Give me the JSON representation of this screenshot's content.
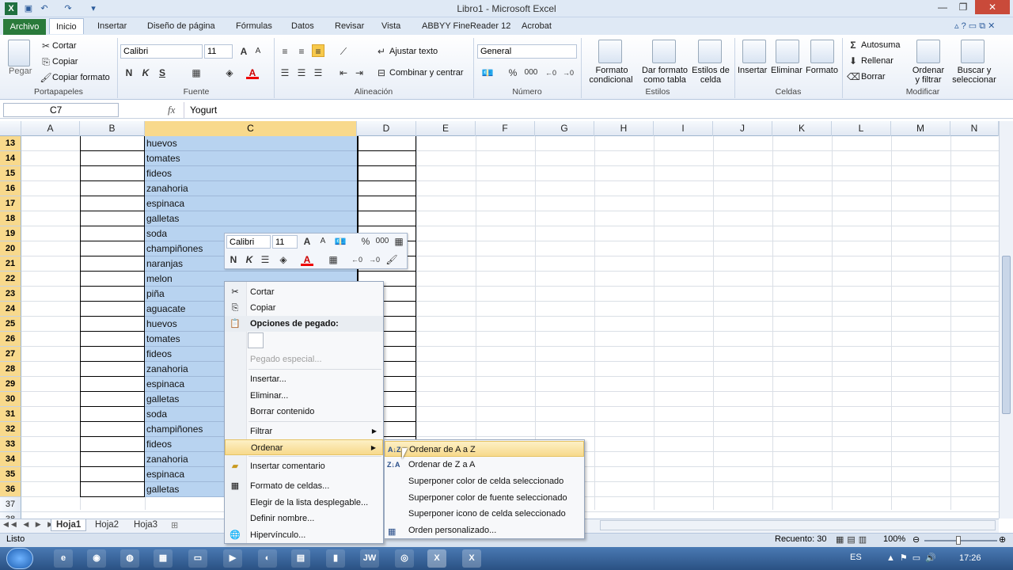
{
  "window": {
    "title": "Libro1 - Microsoft Excel"
  },
  "tabs": [
    "Archivo",
    "Inicio",
    "Insertar",
    "Diseño de página",
    "Fórmulas",
    "Datos",
    "Revisar",
    "Vista",
    "ABBYY FineReader 12",
    "Acrobat"
  ],
  "ribbon": {
    "clipboard": {
      "paste": "Pegar",
      "cut": "Cortar",
      "copy": "Copiar",
      "format_painter": "Copiar formato",
      "label": "Portapapeles"
    },
    "font": {
      "name": "Calibri",
      "size": "11",
      "bold": "N",
      "italic": "K",
      "underline": "S",
      "label": "Fuente"
    },
    "alignment": {
      "wrap": "Ajustar texto",
      "merge": "Combinar y centrar",
      "label": "Alineación"
    },
    "number": {
      "format": "General",
      "percent": "%",
      "thousands": "000",
      "label": "Número"
    },
    "styles": {
      "conditional": "Formato\ncondicional",
      "conditional_1": "Formato",
      "conditional_2": "condicional",
      "table_1": "Dar formato",
      "table_2": "como tabla",
      "cell_1": "Estilos de",
      "cell_2": "celda",
      "label": "Estilos"
    },
    "cells": {
      "insert": "Insertar",
      "delete": "Eliminar",
      "format": "Formato",
      "label": "Celdas"
    },
    "editing": {
      "autosum": "Autosuma",
      "fill": "Rellenar",
      "clear": "Borrar",
      "sort_1": "Ordenar",
      "sort_2": "y filtrar",
      "find_1": "Buscar y",
      "find_2": "seleccionar",
      "label": "Modificar"
    }
  },
  "formula_bar": {
    "name_box": "C7",
    "fx": "fx",
    "value": "Yogurt"
  },
  "columns": [
    "A",
    "B",
    "C",
    "D",
    "E",
    "F",
    "G",
    "H",
    "I",
    "J",
    "K",
    "L",
    "M",
    "N"
  ],
  "rows": [
    {
      "n": "13",
      "c": "huevos"
    },
    {
      "n": "14",
      "c": "tomates"
    },
    {
      "n": "15",
      "c": "fideos"
    },
    {
      "n": "16",
      "c": "zanahoria"
    },
    {
      "n": "17",
      "c": "espinaca"
    },
    {
      "n": "18",
      "c": "galletas"
    },
    {
      "n": "19",
      "c": "soda"
    },
    {
      "n": "20",
      "c": "champiñones"
    },
    {
      "n": "21",
      "c": "naranjas"
    },
    {
      "n": "22",
      "c": "melon"
    },
    {
      "n": "23",
      "c": "piña"
    },
    {
      "n": "24",
      "c": "aguacate"
    },
    {
      "n": "25",
      "c": "huevos"
    },
    {
      "n": "26",
      "c": "tomates"
    },
    {
      "n": "27",
      "c": "fideos"
    },
    {
      "n": "28",
      "c": "zanahoria"
    },
    {
      "n": "29",
      "c": "espinaca"
    },
    {
      "n": "30",
      "c": "galletas"
    },
    {
      "n": "31",
      "c": "soda"
    },
    {
      "n": "32",
      "c": "champiñones"
    },
    {
      "n": "33",
      "c": "fideos"
    },
    {
      "n": "34",
      "c": "zanahoria"
    },
    {
      "n": "35",
      "c": "espinaca"
    },
    {
      "n": "36",
      "c": "galletas"
    },
    {
      "n": "37",
      "c": ""
    },
    {
      "n": "38",
      "c": ""
    }
  ],
  "mini_toolbar": {
    "font": "Calibri",
    "size": "11",
    "percent": "%",
    "thousands": "000",
    "bold": "N",
    "italic": "K"
  },
  "context_menu": {
    "cut": "Cortar",
    "copy": "Copiar",
    "paste_options": "Opciones de pegado:",
    "paste_special": "Pegado especial...",
    "insert": "Insertar...",
    "delete": "Eliminar...",
    "clear": "Borrar contenido",
    "filter": "Filtrar",
    "sort": "Ordenar",
    "comment": "Insertar comentario",
    "format_cells": "Formato de celdas...",
    "pick_list": "Elegir de la lista desplegable...",
    "define_name": "Definir nombre...",
    "hyperlink": "Hipervínculo..."
  },
  "sort_submenu": {
    "a_to_z": "Ordenar de A a Z",
    "z_to_a": "Ordenar de Z a A",
    "cell_color": "Superponer color de celda seleccionado",
    "font_color": "Superponer color de fuente seleccionado",
    "cell_icon": "Superponer icono de celda seleccionado",
    "custom": "Orden personalizado..."
  },
  "sheets": [
    "Hoja1",
    "Hoja2",
    "Hoja3"
  ],
  "status": {
    "ready": "Listo",
    "count": "Recuento: 30",
    "zoom": "100%"
  },
  "taskbar": {
    "lang": "ES",
    "time": "17:26"
  },
  "colors": {
    "selection": "#b8d3f0",
    "header_selected": "#f8d98c",
    "file_tab": "#2a7a3b"
  }
}
